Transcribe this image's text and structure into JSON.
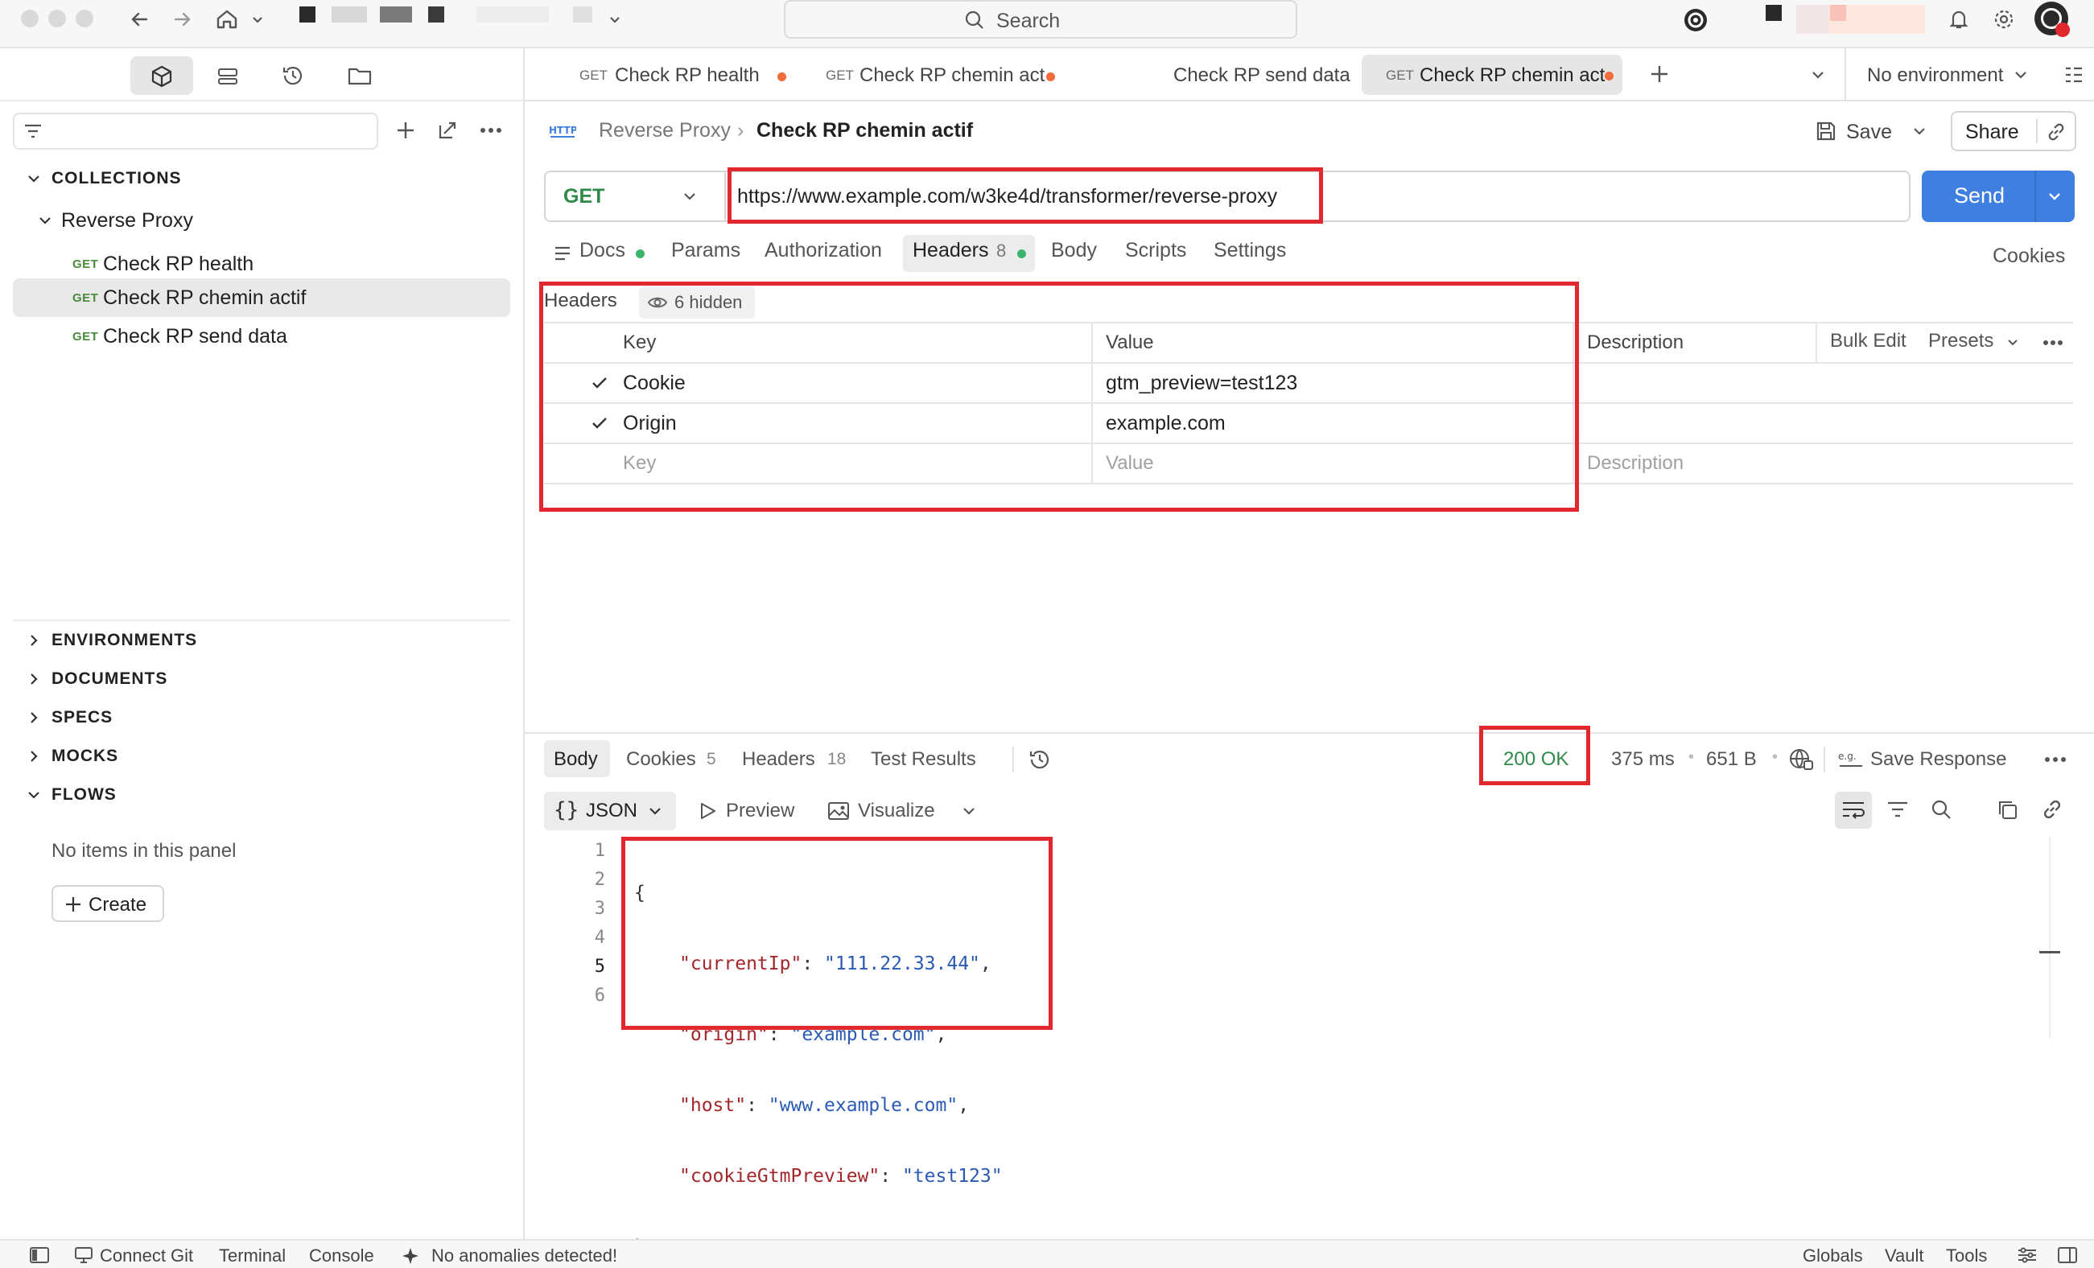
{
  "topbar": {
    "search_label": "Search"
  },
  "sidebar": {
    "collections_label": "COLLECTIONS",
    "collection_name": "Reverse Proxy",
    "requests": [
      {
        "method": "GET",
        "name": "Check RP health"
      },
      {
        "method": "GET",
        "name": "Check RP chemin actif"
      },
      {
        "method": "GET",
        "name": "Check RP send data"
      }
    ],
    "sections": [
      "ENVIRONMENTS",
      "DOCUMENTS",
      "SPECS",
      "MOCKS",
      "FLOWS"
    ],
    "empty_text": "No items in this panel",
    "create_label": "Create"
  },
  "tabs": [
    {
      "method": "GET",
      "label": "Check RP health"
    },
    {
      "method": "GET",
      "label": "Check RP chemin act"
    },
    {
      "method": "",
      "label": "Check RP send data"
    },
    {
      "method": "GET",
      "label": "Check RP chemin act"
    }
  ],
  "environment": "No environment",
  "request": {
    "breadcrumb_parent": "Reverse Proxy",
    "breadcrumb_current": "Check RP chemin actif",
    "save_label": "Save",
    "share_label": "Share",
    "method": "GET",
    "url": "https://www.example.com/w3ke4d/transformer/reverse-proxy",
    "send_label": "Send",
    "subtabs": {
      "docs": "Docs",
      "params": "Params",
      "authorization": "Authorization",
      "headers": "Headers",
      "headers_count": "8",
      "body": "Body",
      "scripts": "Scripts",
      "settings": "Settings",
      "cookies": "Cookies"
    }
  },
  "headers_table": {
    "title": "Headers",
    "hidden_label": "6 hidden",
    "col_key": "Key",
    "col_value": "Value",
    "col_description": "Description",
    "bulk_edit": "Bulk Edit",
    "presets": "Presets",
    "rows": [
      {
        "key": "Cookie",
        "value": "gtm_preview=test123"
      },
      {
        "key": "Origin",
        "value": "example.com"
      }
    ],
    "placeholder_key": "Key",
    "placeholder_value": "Value",
    "placeholder_description": "Description"
  },
  "response": {
    "tabs": {
      "body": "Body",
      "cookies": "Cookies",
      "cookies_count": "5",
      "headers": "Headers",
      "headers_count": "18",
      "test_results": "Test Results"
    },
    "status": "200 OK",
    "time": "375 ms",
    "size": "651 B",
    "save_response": "Save Response",
    "format": "JSON",
    "preview": "Preview",
    "visualize": "Visualize",
    "line_numbers": [
      "1",
      "2",
      "3",
      "4",
      "5",
      "6"
    ],
    "json": {
      "open": "{",
      "close": "}",
      "lines": [
        {
          "key": "\"currentIp\"",
          "value": "\"111.22.33.44\"",
          "comma": ","
        },
        {
          "key": "\"origin\"",
          "value": "\"example.com\"",
          "comma": ","
        },
        {
          "key": "\"host\"",
          "value": "\"www.example.com\"",
          "comma": ","
        },
        {
          "key": "\"cookieGtmPreview\"",
          "value": "\"test123\"",
          "comma": ""
        }
      ]
    }
  },
  "statusbar": {
    "connect_git": "Connect Git",
    "terminal": "Terminal",
    "console": "Console",
    "anomalies": "No anomalies detected!",
    "globals": "Globals",
    "vault": "Vault",
    "tools": "Tools"
  },
  "colors": {
    "accent_blue": "#3f7fe0",
    "status_green": "#2f8a4a",
    "highlight_red": "#e0282e",
    "unsaved_orange": "#f26b3a"
  }
}
